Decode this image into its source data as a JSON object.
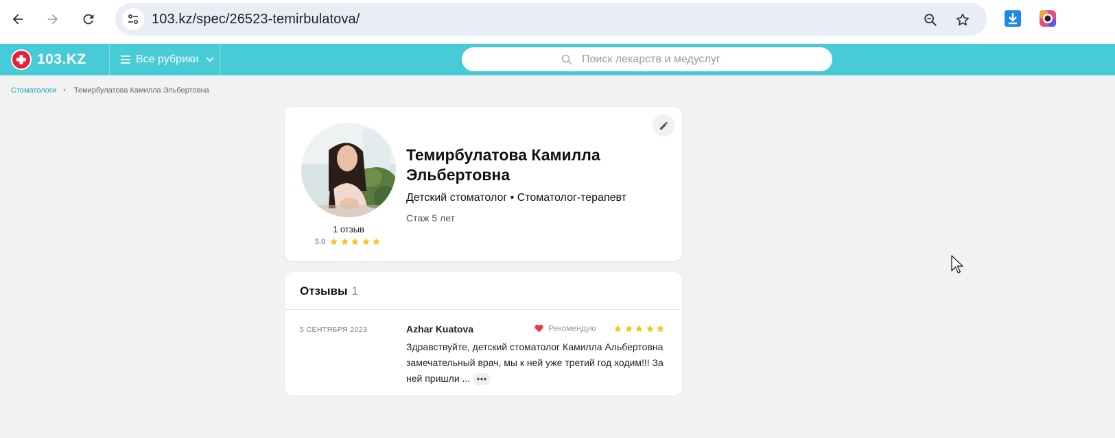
{
  "browser": {
    "url": "103.kz/spec/26523-temirbulatova/",
    "icons": [
      "back-icon",
      "forward-icon",
      "reload-icon",
      "site-settings-icon",
      "zoom-out-icon",
      "bookmark-star-icon",
      "download-icon",
      "extension-icon"
    ]
  },
  "header": {
    "logo_text": "103.KZ",
    "rubrics_label": "Все рубрики",
    "search_placeholder": "Поиск лекарств и медуслуг",
    "brand_color": "#47cbd6"
  },
  "breadcrumb": {
    "parent": "Стоматологи",
    "separator": "•",
    "current": "Темирбулатова Камилла Эльбертовна"
  },
  "profile": {
    "name": "Темирбулатова Камилла Эльбертовна",
    "specialties": "Детский стоматолог • Стоматолог-терапевт",
    "experience": "Стаж 5 лет",
    "review_count": "1 отзыв",
    "rating": "5.0",
    "stars": 5
  },
  "reviews": {
    "title": "Отзывы",
    "count": "1",
    "items": [
      {
        "date": "5 СЕНТЯБРЯ 2023",
        "author": "Azhar Kuatova",
        "recommend": "Рекомендую",
        "stars": 5,
        "text": "Здравствуйте, детский стоматолог Камилла Альбертовна замечательный врач, мы к ней уже третий год ходим!!! За ней пришли ..."
      }
    ]
  }
}
